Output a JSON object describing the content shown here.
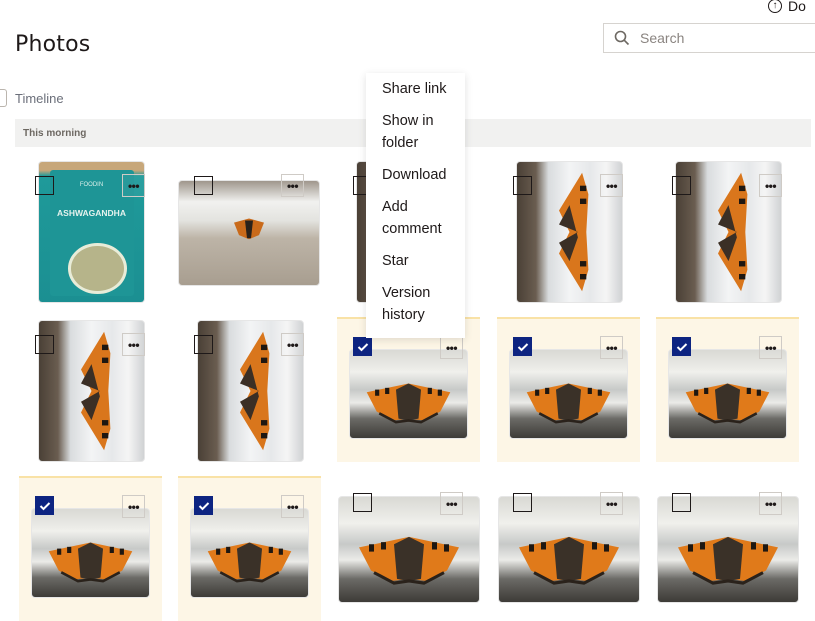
{
  "header": {
    "top_link_label": "Do",
    "title": "Photos",
    "search": {
      "placeholder": "Search",
      "value": ""
    }
  },
  "view": {
    "timeline_label": "Timeline"
  },
  "section": {
    "label": "This morning"
  },
  "photos": [
    {
      "subject": "Ashwagandha powder package",
      "orientation": "portrait",
      "selected": false
    },
    {
      "subject": "Butterfly on window frame",
      "orientation": "landscape",
      "selected": false
    },
    {
      "subject": "Butterfly on window frame",
      "orientation": "portrait",
      "selected": false
    },
    {
      "subject": "Butterfly on window frame",
      "orientation": "portrait",
      "selected": false
    },
    {
      "subject": "Butterfly on window frame",
      "orientation": "portrait",
      "selected": false
    },
    {
      "subject": "Butterfly on window frame",
      "orientation": "portrait",
      "selected": false
    },
    {
      "subject": "Butterfly on window frame",
      "orientation": "portrait",
      "selected": false
    },
    {
      "subject": "Butterfly on window sill",
      "orientation": "landscape",
      "selected": true
    },
    {
      "subject": "Butterfly on window sill",
      "orientation": "landscape",
      "selected": true
    },
    {
      "subject": "Butterfly on window sill",
      "orientation": "landscape",
      "selected": true
    },
    {
      "subject": "Butterfly on window sill",
      "orientation": "landscape",
      "selected": true
    },
    {
      "subject": "Butterfly on window sill",
      "orientation": "landscape",
      "selected": true
    },
    {
      "subject": "Butterfly on window sill",
      "orientation": "landscape",
      "selected": false
    },
    {
      "subject": "Butterfly on window sill",
      "orientation": "landscape",
      "selected": false
    },
    {
      "subject": "Butterfly on window sill",
      "orientation": "landscape",
      "selected": false
    }
  ],
  "package_label": {
    "brand": "FOODIN",
    "product": "ASHWAGANDHA"
  },
  "context_menu": {
    "items": [
      "Share link",
      "Show in folder",
      "Download",
      "Add comment",
      "Star",
      "Version history"
    ]
  },
  "more_label": "•••",
  "colors": {
    "checkbox_checked": "#0d2481",
    "selected_tile_bg": "#fdf6e6",
    "selected_tile_border": "#f9e2a6",
    "section_bg": "#f1f1f0"
  }
}
